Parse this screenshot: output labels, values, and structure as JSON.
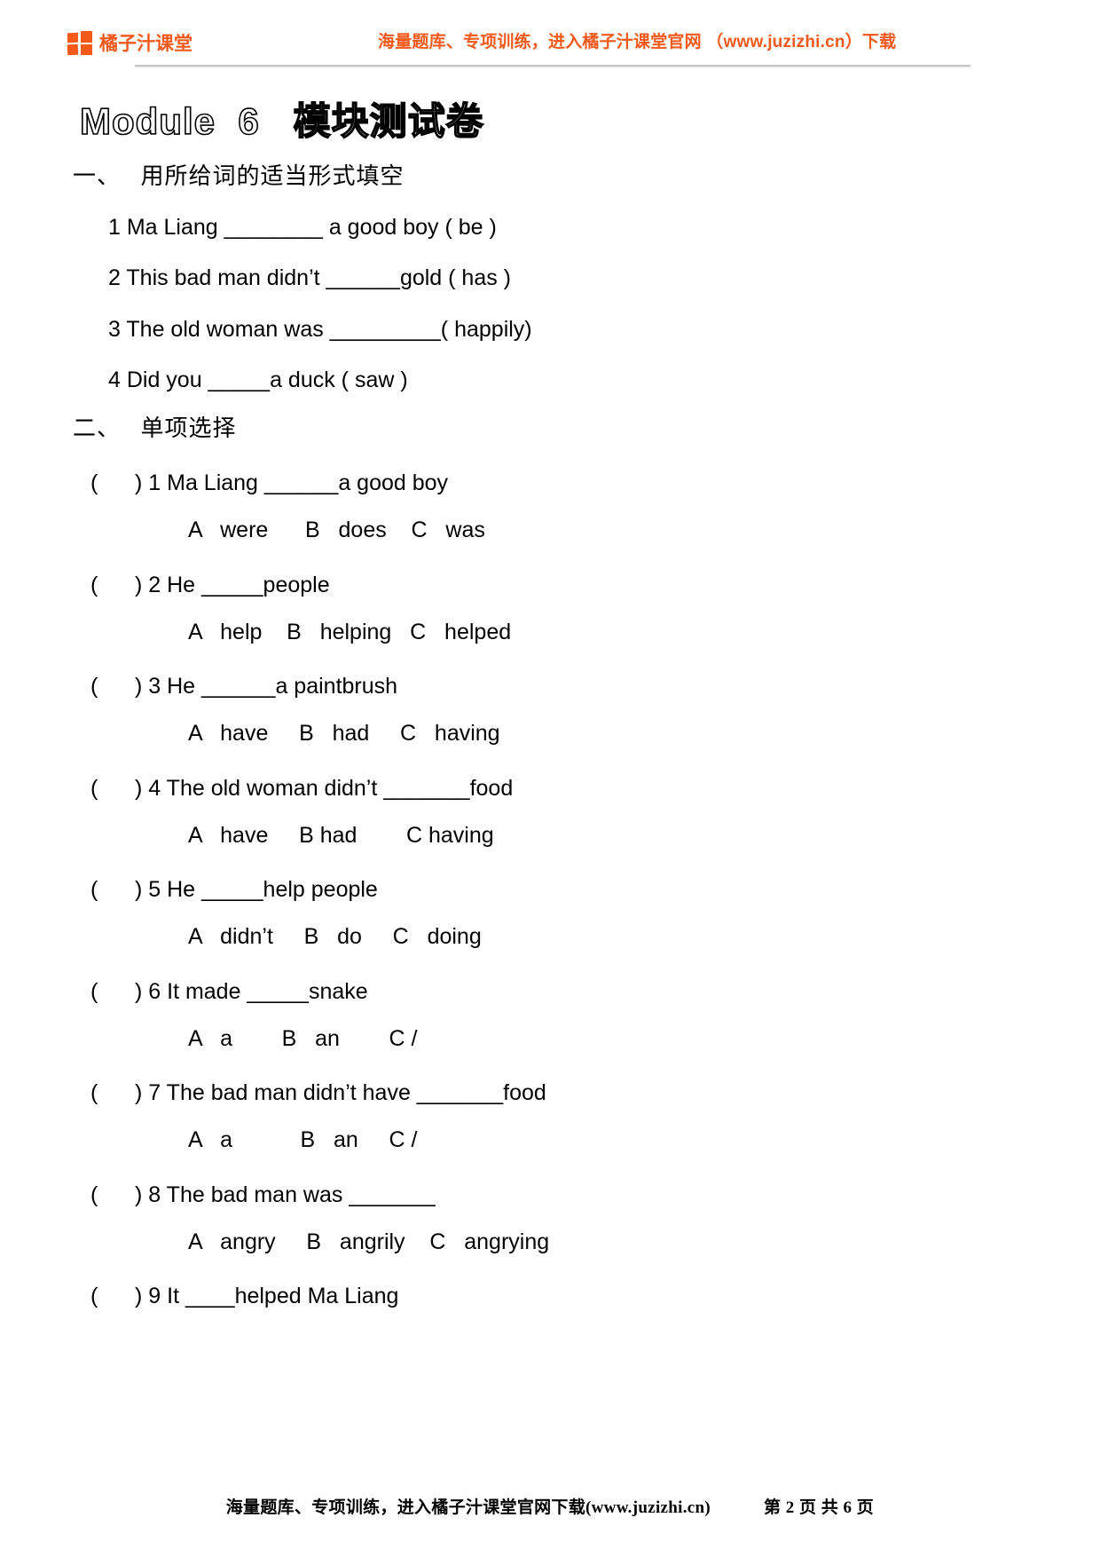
{
  "header": {
    "brand_name": "橘子汁课堂",
    "logo_icon": "four-squares-logo-icon",
    "promo_text": "海量题库、专项训练，进入橘子汁课堂官网 （www.juzizhi.cn）下载",
    "accent_color": "#f2591b"
  },
  "title": "Module  6   模块测试卷",
  "sections": [
    {
      "label": "一、",
      "heading": "用所给词的适当形式填空",
      "questions": [
        {
          "text": "1 Ma Liang ________ a good boy ( be )"
        },
        {
          "text": "2 This bad man didn’t ______gold ( has )"
        },
        {
          "text": "3 The old woman was _________( happily)"
        },
        {
          "text": "4 Did you _____a duck ( saw )"
        }
      ]
    },
    {
      "label": "二、",
      "heading": "单项选择",
      "questions": [
        {
          "stem": "(      ) 1 Ma Liang ______a good boy",
          "options": "A   were      B   does    C   was"
        },
        {
          "stem": "(      ) 2 He _____people",
          "options": "A   help    B   helping   C   helped"
        },
        {
          "stem": "(      ) 3 He ______a paintbrush",
          "options": "A   have     B   had     C   having"
        },
        {
          "stem": "(      ) 4 The old woman didn’t _______food",
          "options": "A   have     B had        C having"
        },
        {
          "stem": "(      ) 5 He _____help people",
          "options": "A   didn’t     B   do     C   doing"
        },
        {
          "stem": "(      ) 6 It made _____snake",
          "options": "A   a        B   an        C /"
        },
        {
          "stem": "(      ) 7 The bad man didn’t have _______food",
          "options": "A   a           B   an     C /"
        },
        {
          "stem": "(      ) 8 The bad man was _______",
          "options": "A   angry     B   angrily    C   angrying"
        },
        {
          "stem": "(      ) 9 It ____helped Ma Liang",
          "options": ""
        }
      ]
    }
  ],
  "footer": {
    "note": "海量题库、专项训练，进入橘子汁课堂官网下载(www.juzizhi.cn)",
    "page_label": "第 2 页 共 6 页"
  }
}
